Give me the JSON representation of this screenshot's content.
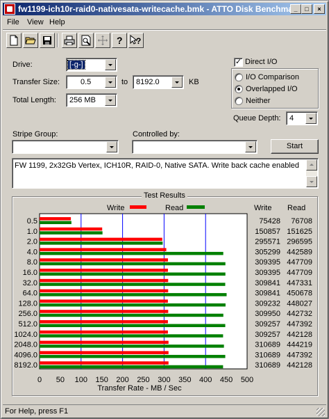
{
  "window": {
    "title": "fw1199-ich10r-raid0-nativesata-writecache.bmk - ATTO Disk Benchmark"
  },
  "menu": [
    {
      "label": "File"
    },
    {
      "label": "View"
    },
    {
      "label": "Help"
    }
  ],
  "toolbar": {
    "icons": [
      "new-icon",
      "open-icon",
      "save-icon",
      "print-icon",
      "print-preview-icon",
      "move-icon",
      "help-icon",
      "context-help-icon"
    ]
  },
  "form": {
    "drive_label": "Drive:",
    "drive_value": "[-g-]",
    "transfer_size_label": "Transfer Size:",
    "transfer_from": "0.5",
    "to_label": "to",
    "transfer_to": "8192.0",
    "kb_label": "KB",
    "total_length_label": "Total Length:",
    "total_length_value": "256 MB",
    "direct_io_label": "Direct I/O",
    "direct_io_checked": "✓",
    "io_comparison_label": "I/O Comparison",
    "overlapped_io_label": "Overlapped I/O",
    "neither_label": "Neither",
    "queue_depth_label": "Queue Depth:",
    "queue_depth_value": "4",
    "stripe_group_label": "Stripe Group:",
    "controlled_by_label": "Controlled by:",
    "start_label": "Start",
    "description": "FW 1199, 2x32Gb Vertex, ICH10R, RAID-0, Native SATA. Write back cache enabled"
  },
  "results": {
    "title": "Test Results",
    "write_legend": "Write",
    "read_legend": "Read",
    "write_header": "Write",
    "read_header": "Read",
    "xlabel": "Transfer Rate - MB / Sec"
  },
  "colors": {
    "write": "#ff0000",
    "read": "#008000",
    "gridline": "#0000ff"
  },
  "chart_data": {
    "type": "bar",
    "orientation": "horizontal",
    "categories": [
      "0.5",
      "1.0",
      "2.0",
      "4.0",
      "8.0",
      "16.0",
      "32.0",
      "64.0",
      "128.0",
      "256.0",
      "512.0",
      "1024.0",
      "2048.0",
      "4096.0",
      "8192.0"
    ],
    "series": [
      {
        "name": "Write",
        "values": [
          75428,
          150857,
          295571,
          305299,
          309395,
          309395,
          309841,
          309841,
          309232,
          309950,
          309257,
          309257,
          310689,
          310689,
          310689
        ],
        "labels": [
          "75428",
          "150857",
          "295571",
          "305299",
          "309395",
          "309395",
          "309841",
          "309841",
          "309232",
          "309950",
          "309257",
          "309257",
          "310689",
          "310689",
          "310689"
        ]
      },
      {
        "name": "Read",
        "values": [
          76708,
          151625,
          296595,
          442589,
          447709,
          447709,
          447331,
          450678,
          448027,
          442732,
          447392,
          442128,
          444219,
          447392,
          442128
        ],
        "labels": [
          "76708",
          "151625",
          "296595",
          "442589",
          "447709",
          "447709",
          "447331",
          "450678",
          "448027",
          "442732",
          "447392",
          "442128",
          "444219",
          "447392",
          "442128"
        ]
      }
    ],
    "xticks": [
      "0",
      "50",
      "100",
      "150",
      "200",
      "250",
      "300",
      "350",
      "400",
      "450",
      "500"
    ],
    "xlim": [
      0,
      500
    ],
    "xlabel": "Transfer Rate - MB / Sec",
    "grid": true,
    "legend": "top"
  },
  "status": {
    "text": "For Help, press F1"
  }
}
